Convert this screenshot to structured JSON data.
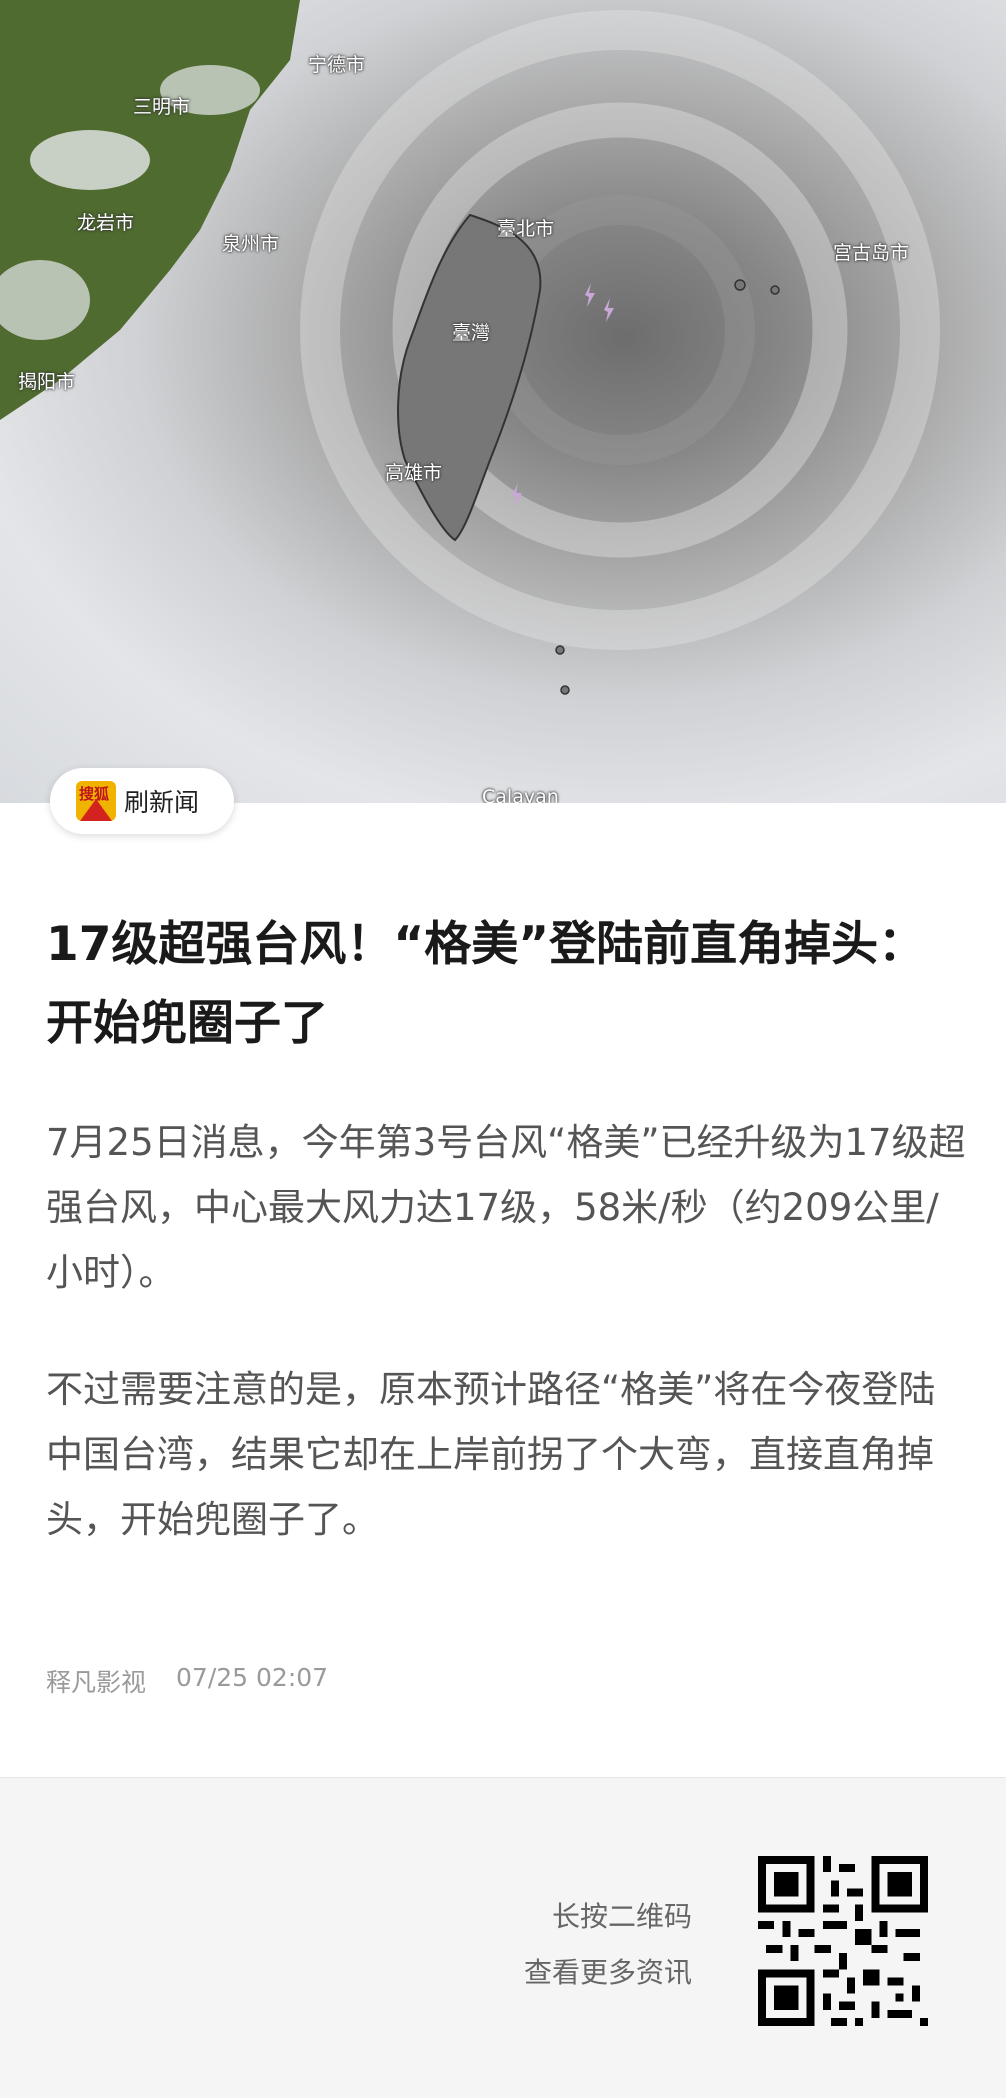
{
  "hero": {
    "map_labels": {
      "ningde": "宁德市",
      "sanming": "三明市",
      "longyan": "龙岩市",
      "quanzhou": "泉州市",
      "jieyang": "揭阳市",
      "taibei": "臺北市",
      "taiwan": "臺灣",
      "gaoxiong": "高雄市",
      "miyako": "宫古岛市",
      "calayan": "Calayan"
    }
  },
  "badge": {
    "logo_char": "搜狐",
    "label": "刷新闻"
  },
  "article": {
    "title": "17级超强台风！“格美”登陆前直角掉头：开始兜圈子了",
    "paragraphs": [
      "7月25日消息，今年第3号台风“格美”已经升级为17级超强台风，中心最大风力达17级，58米/秒（约209公里/小时）。",
      "不过需要注意的是，原本预计路径“格美”将在今夜登陆中国台湾，结果它却在上岸前拐了个大弯，直接直角掉头，开始兜圈子了。"
    ],
    "source": "释凡影视",
    "time": "07/25 02:07"
  },
  "footer": {
    "hint_line1": "长按二维码",
    "hint_line2": "查看更多资讯"
  },
  "colors": {
    "title": "#1a1a1a",
    "body": "#555555",
    "meta": "#9a9a9a",
    "footer_bg": "#f5f5f5",
    "logo_bg": "#f0b300"
  }
}
